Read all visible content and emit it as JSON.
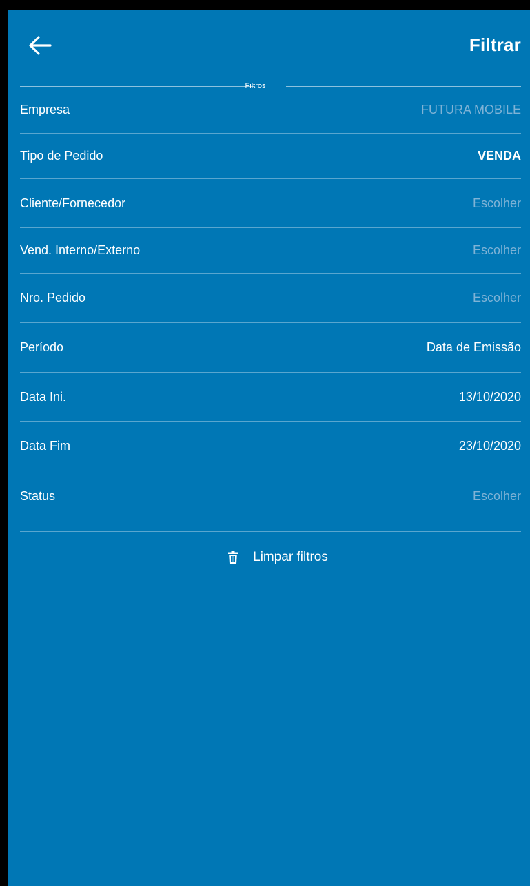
{
  "header": {
    "back_icon": "arrow-left-icon",
    "action_label": "Filtrar"
  },
  "section": {
    "title": "Filtros"
  },
  "filters": [
    {
      "label": "Empresa",
      "value": "FUTURA MOBILE",
      "style": "muted"
    },
    {
      "label": "Tipo de Pedido",
      "value": "VENDA",
      "style": "bold"
    },
    {
      "label": "Cliente/Fornecedor",
      "value": "Escolher",
      "style": "muted"
    },
    {
      "label": "Vend. Interno/Externo",
      "value": "Escolher",
      "style": "muted"
    },
    {
      "label": "Nro. Pedido",
      "value": "Escolher",
      "style": "muted"
    },
    {
      "label": "Período",
      "value": "Data de Emissão",
      "style": "normal"
    },
    {
      "label": "Data Ini.",
      "value": "13/10/2020",
      "style": "normal"
    },
    {
      "label": "Data Fim",
      "value": "23/10/2020",
      "style": "normal"
    },
    {
      "label": "Status",
      "value": "Escolher",
      "style": "muted"
    }
  ],
  "clear": {
    "icon": "trash-icon",
    "label": "Limpar filtros"
  },
  "colors": {
    "background": "#0077b5",
    "text": "#ffffff",
    "muted_text": "#7fb3d6",
    "outer_frame": "#000000"
  }
}
